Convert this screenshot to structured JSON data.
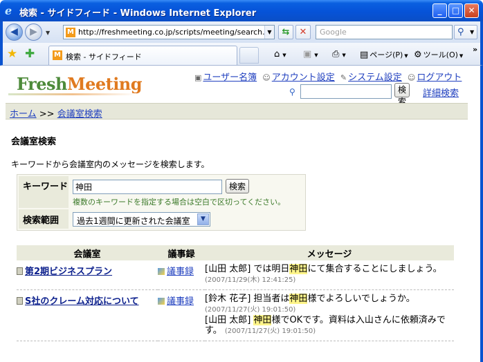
{
  "window": {
    "title": "検索 - サイドフィード - Windows Internet Explorer"
  },
  "address": {
    "url": "http://freshmeeting.co.jp/scripts/meeting/search.ph",
    "search_placeholder": "Google"
  },
  "tab": {
    "label": "検索 - サイドフィード"
  },
  "commands": {
    "page": "ページ(P)",
    "tools": "ツール(O)"
  },
  "site": {
    "logo_fresh": "Fresh",
    "logo_meeting": "Meeting"
  },
  "toplinks": {
    "users": "ユーザー名簿",
    "account": "アカウント設定",
    "system": "システム設定",
    "logout": "ログアウト"
  },
  "topsearch": {
    "button": "検索",
    "advanced": "詳細検索"
  },
  "breadcrumb": {
    "home": "ホーム",
    "sep": ">>",
    "current": "会議室検索"
  },
  "heading": "会議室検索",
  "description": "キーワードから会議室内のメッセージを検索します。",
  "form": {
    "keyword_label": "キーワード",
    "keyword_value": "神田",
    "search_button": "検索",
    "hint": "複数のキーワードを指定する場合は空白で区切ってください。",
    "range_label": "検索範囲",
    "range_value": "過去1週間に更新された会議室"
  },
  "results": {
    "headers": {
      "room": "会議室",
      "minutes": "議事録",
      "message": "メッセージ"
    },
    "rows": [
      {
        "room": "第2期ビジネスプラン",
        "minutes": "議事録",
        "messages": [
          {
            "pre": "[山田 太郎] では明日",
            "hl": "神田",
            "post": "にて集合することにしましょう。",
            "ts": "(2007/11/29(木) 12:41:25)"
          }
        ]
      },
      {
        "room": "S社のクレーム対応について",
        "minutes": "議事録",
        "messages": [
          {
            "pre": "[鈴木 花子] 担当者は",
            "hl": "神田",
            "post": "様でよろしいでしょうか。",
            "ts": "(2007/11/27(火) 19:01:50)"
          },
          {
            "pre": "[山田 太郎] ",
            "hl": "神田",
            "post": "様でOKです。資料は入山さんに依頼済みです。",
            "ts": "(2007/11/27(火) 19:01:50)"
          }
        ]
      }
    ]
  }
}
